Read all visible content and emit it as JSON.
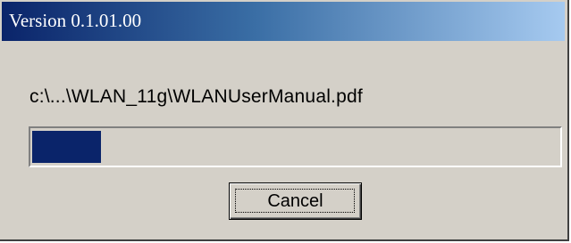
{
  "window": {
    "title": "Version 0.1.01.00"
  },
  "main": {
    "file_path": "c:\\...\\WLAN_11g\\WLANUserManual.pdf",
    "progress_fraction": 0.13
  },
  "buttons": {
    "cancel_label": "Cancel"
  },
  "colors": {
    "title_gradient_start": "#0a246a",
    "title_gradient_end": "#a6caf0",
    "progress_fill": "#0a246a",
    "dialog_face": "#d4d0c8"
  }
}
